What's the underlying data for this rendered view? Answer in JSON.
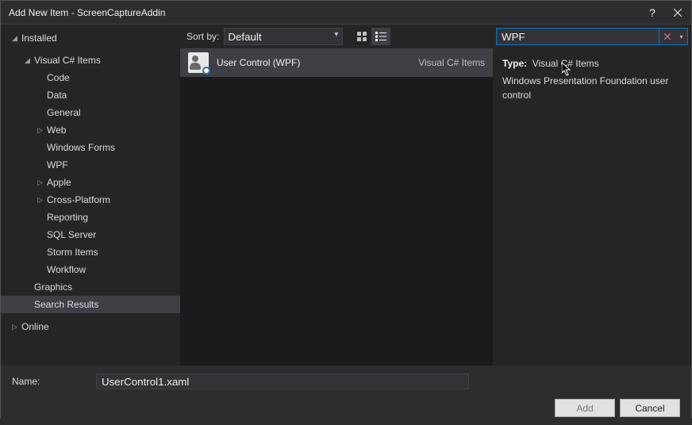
{
  "title": "Add New Item - ScreenCaptureAddin",
  "tree": {
    "installed": "Installed",
    "csharp_items": "Visual C# Items",
    "code": "Code",
    "data": "Data",
    "general": "General",
    "web": "Web",
    "windows_forms": "Windows Forms",
    "wpf": "WPF",
    "apple": "Apple",
    "cross_platform": "Cross-Platform",
    "reporting": "Reporting",
    "sql_server": "SQL Server",
    "storm_items": "Storm Items",
    "workflow": "Workflow",
    "graphics": "Graphics",
    "search_results": "Search Results",
    "online": "Online"
  },
  "sort": {
    "label": "Sort by:",
    "value": "Default"
  },
  "items": [
    {
      "name": "User Control (WPF)",
      "type": "Visual C# Items"
    }
  ],
  "search": {
    "value": "WPF"
  },
  "detail": {
    "type_label": "Type:",
    "type_value": "Visual C# Items",
    "description": "Windows Presentation Foundation user control"
  },
  "name_field": {
    "label": "Name:",
    "value": "UserControl1.xaml"
  },
  "buttons": {
    "add": "Add",
    "cancel": "Cancel"
  }
}
